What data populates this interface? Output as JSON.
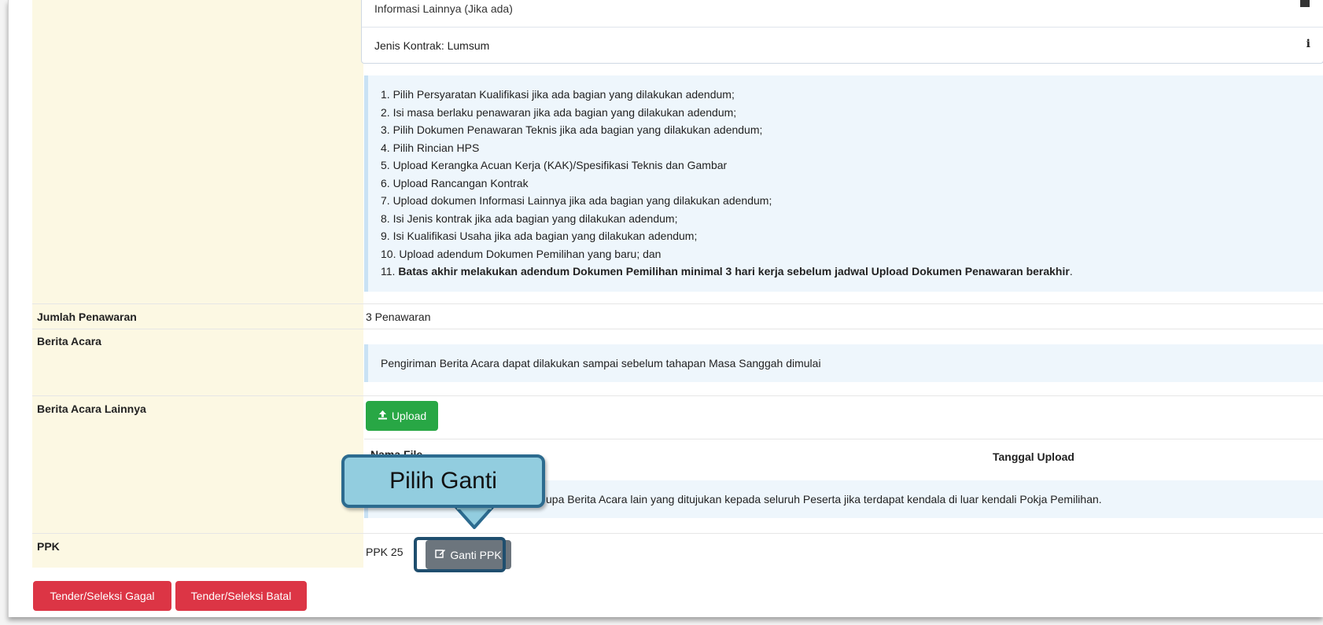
{
  "top_list": {
    "partial_row": "Informasi Lainnya (Jika ada)",
    "contract_row": "Jenis Kontrak: Lumsum",
    "contract_icon_glyph": "i"
  },
  "instructions": [
    "1. Pilih Persyaratan Kualifikasi jika ada bagian yang dilakukan adendum;",
    "2. Isi masa berlaku penawaran jika ada bagian yang dilakukan adendum;",
    "3. Pilih Dokumen Penawaran Teknis jika ada bagian yang dilakukan adendum;",
    "4. Pilih Rincian HPS",
    "5. Upload Kerangka Acuan Kerja (KAK)/Spesifikasi Teknis dan Gambar",
    "6. Upload Rancangan Kontrak",
    "7. Upload dokumen Informasi Lainnya jika ada bagian yang dilakukan adendum;",
    "8. Isi Jenis kontrak jika ada bagian yang dilakukan adendum;",
    "9. Isi Kualifikasi Usaha jika ada bagian yang dilakukan adendum;",
    "10. Upload adendum Dokumen Pemilihan yang baru; dan"
  ],
  "instruction_last": {
    "number": "11. ",
    "bold": "Batas akhir melakukan adendum Dokumen Pemilihan minimal 3 hari kerja sebelum jadwal Upload Dokumen Penawaran berakhir",
    "end": "."
  },
  "jumlah_penawaran": {
    "label": "Jumlah Penawaran",
    "value": "3 Penawaran"
  },
  "berita_acara": {
    "label": "Berita Acara",
    "note": "Pengiriman Berita Acara dapat dilakukan sampai sebelum tahapan Masa Sanggah dimulai"
  },
  "berita_acara_lainnya": {
    "label": "Berita Acara Lainnya",
    "upload_label": "Upload",
    "col_nama_file": "Nama File",
    "col_tanggal_upload": "Tanggal Upload",
    "note": "upa Berita Acara lain yang ditujukan kepada seluruh Peserta jika terdapat kendala di luar kendali Pokja Pemilihan."
  },
  "ppk": {
    "label": "PPK",
    "value": "PPK 25",
    "ganti_label": "Ganti PPK"
  },
  "actions": {
    "gagal": "Tender/Seleksi Gagal",
    "batal": "Tender/Seleksi Batal"
  },
  "callout": {
    "text": "Pilih Ganti"
  },
  "colors": {
    "label_bg": "#fcf8e3",
    "info_bg": "#eef6fc",
    "green": "#28a745",
    "red": "#dc3545",
    "gray": "#6c757d",
    "callout_fill": "#92cddf",
    "callout_border": "#2c6b8f"
  },
  "icons": {
    "upload": "upload-icon",
    "edit": "edit-icon",
    "info": "info-icon",
    "file": "file-icon"
  }
}
